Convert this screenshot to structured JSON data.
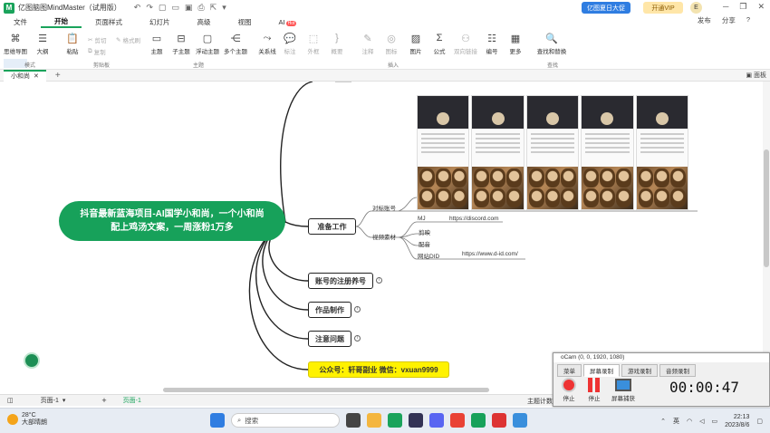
{
  "titlebar": {
    "title": "亿图脑图MindMaster（试用版）",
    "promo": "亿图夏日大促",
    "vip": "开通VIP",
    "avatar": "E"
  },
  "menu": {
    "items": [
      "文件",
      "开始",
      "页面样式",
      "幻灯片",
      "高级",
      "视图",
      "AI"
    ],
    "hot": "Hot",
    "right": [
      "发布",
      "分享",
      "?"
    ]
  },
  "ribbon": {
    "buttons": [
      {
        "label": "思维导图",
        "icon": "mindmap-icon"
      },
      {
        "label": "大纲",
        "icon": "outline-icon"
      },
      {
        "label": "粘贴",
        "icon": "paste-icon"
      },
      {
        "label": "主题",
        "icon": "topic-icon"
      },
      {
        "label": "子主题",
        "icon": "subtopic-icon"
      },
      {
        "label": "浮动主题",
        "icon": "float-topic-icon"
      },
      {
        "label": "多个主题",
        "icon": "multi-topic-icon"
      },
      {
        "label": "关系线",
        "icon": "relation-icon"
      },
      {
        "label": "标注",
        "icon": "callout-icon"
      },
      {
        "label": "外框",
        "icon": "boundary-icon"
      },
      {
        "label": "概要",
        "icon": "summary-icon"
      },
      {
        "label": "注释",
        "icon": "note-icon"
      },
      {
        "label": "图标",
        "icon": "mark-icon"
      },
      {
        "label": "图片",
        "icon": "image-icon"
      },
      {
        "label": "公式",
        "icon": "formula-icon"
      },
      {
        "label": "双向链接",
        "icon": "link-icon"
      },
      {
        "label": "编号",
        "icon": "numbering-icon"
      },
      {
        "label": "更多",
        "icon": "more-icon"
      },
      {
        "label": "查找和替换",
        "icon": "find-icon"
      }
    ],
    "small": [
      "剪切",
      "复制",
      "格式刷"
    ],
    "groups": [
      "模式",
      "剪贴板",
      "主题",
      "插入",
      "查找"
    ]
  },
  "tab": {
    "name": "小和尚",
    "panel": "面板"
  },
  "mindmap": {
    "root": [
      "抖音最新蓝海项目-AI国学小和尚，一个小和尚",
      "配上鸡汤文案，一周涨粉1万多"
    ],
    "branches": [
      "准备工作",
      "账号的注册养号",
      "作品制作",
      "注意问题",
      "公众号：轩哥副业   微信：vxuan9999"
    ],
    "prep": {
      "a": "对标账号",
      "b": "视频素材",
      "mj": "MJ",
      "mj_url": "https://discord.com",
      "c": "剪映",
      "d": "配音",
      "e": "网站DID",
      "e_url": "https://www.d-id.com/"
    }
  },
  "statusbar": {
    "page_select": "页面-1",
    "page_tab": "页面-1",
    "right": "主题计数"
  },
  "ocam": {
    "title": "oCam (0, 0, 1920, 1080)",
    "tabs": [
      "菜单",
      "屏幕录制",
      "游戏录制",
      "音频录制"
    ],
    "btns": [
      "停止",
      "停止",
      "屏幕捕获"
    ],
    "timer": "00:00:47"
  },
  "taskbar": {
    "temp": "28°C",
    "weather": "大部晴朗",
    "search": "搜索",
    "lang": "英",
    "time": "22:13",
    "date": "2023/8/6"
  }
}
